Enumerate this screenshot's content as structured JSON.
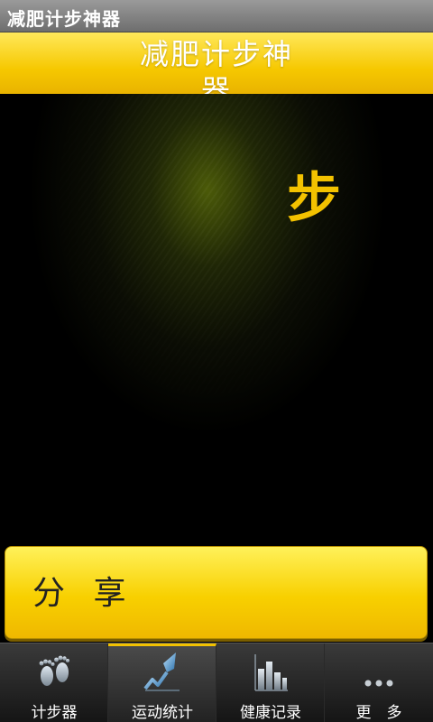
{
  "titlebar": {
    "title": "减肥计步神器"
  },
  "header": {
    "title": "减肥计步神器"
  },
  "main": {
    "steps_unit": "步"
  },
  "share_button": {
    "label": "分 享"
  },
  "tabs": [
    {
      "label": "计步器",
      "icon": "footprints-icon"
    },
    {
      "label": "运动统计",
      "icon": "arrow-chart-icon",
      "active": true
    },
    {
      "label": "健康记录",
      "icon": "bar-chart-icon"
    },
    {
      "label": "更　多",
      "icon": "more-dots-icon"
    }
  ],
  "colors": {
    "accent": "#f3c200",
    "header": "#f6c800",
    "background": "#000000"
  }
}
